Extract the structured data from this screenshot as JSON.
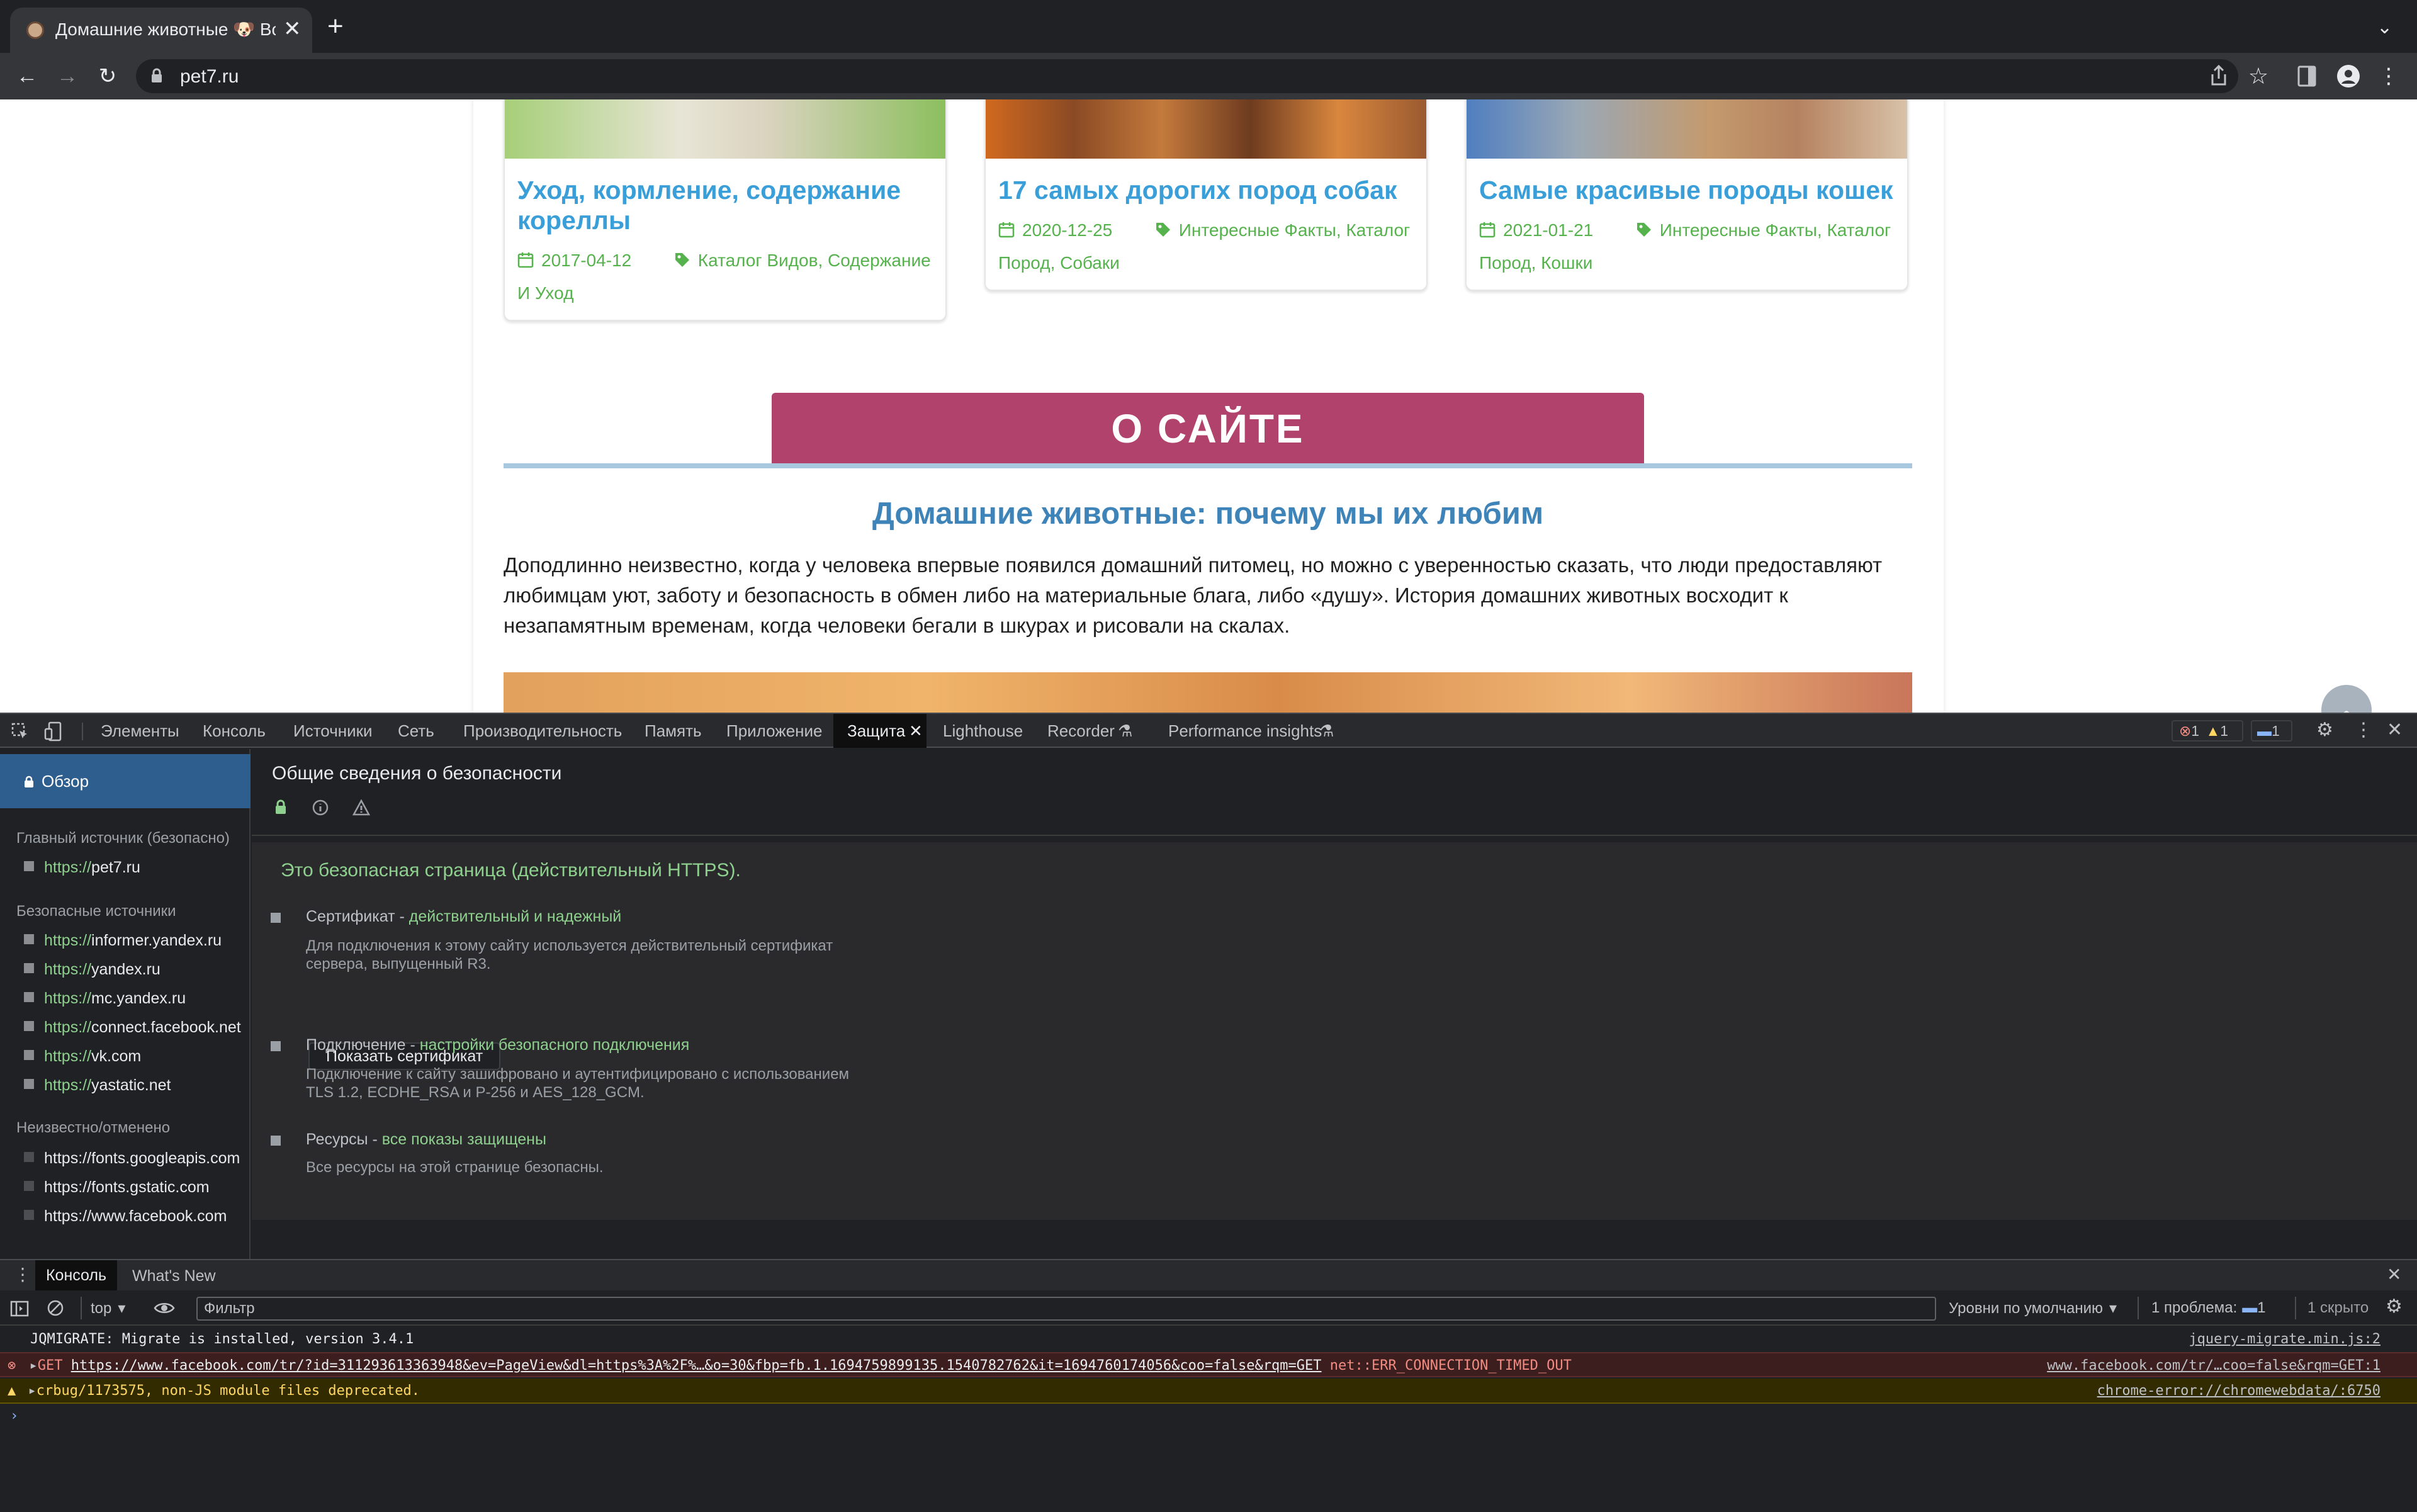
{
  "browser": {
    "tab_title": "Домашние животные 🐶 Все о",
    "url": "pet7.ru"
  },
  "page": {
    "cards": [
      {
        "title": "Уход, кормление, содержание кореллы",
        "date": "2017-04-12",
        "tags": "Каталог Видов, Содержание И Уход",
        "img_color": "#8fc164"
      },
      {
        "title": "17 самых дорогих пород собак",
        "date": "2020-12-25",
        "tags": "Интересные Факты, Каталог Пород, Собаки",
        "img_color": "#b5652d"
      },
      {
        "title": "Самые красивые породы кошек",
        "date": "2021-01-21",
        "tags": "Интересные Факты, Каталог Пород, Кошки",
        "img_color": "#b68a6a"
      }
    ],
    "about_banner": "О САЙТЕ",
    "about_heading": "Домашние животные: почему мы их любим",
    "about_text": "Доподлинно  неизвестно, когда у человека впервые появился домашний питомец, но можно с уверенностью сказать, что люди предоставляют любимцам уют, заботу и безопасность в обмен либо на материальные блага, либо «душу». История домашних животных восходит к незапамятным временам, когда человеки бегали в шкурах и рисовали на скалах."
  },
  "devtools": {
    "tabs": [
      "Элементы",
      "Консоль",
      "Источники",
      "Сеть",
      "Производительность",
      "Память",
      "Приложение",
      "Защита",
      "Lighthouse",
      "Recorder",
      "Performance insights"
    ],
    "active_tab": "Защита",
    "badges": {
      "errors": "1",
      "warnings": "1",
      "messages": "1"
    },
    "sidebar": {
      "overview": "Обзор",
      "main_origin_label": "Главный источник (безопасно)",
      "main_origin": {
        "scheme": "https://",
        "host": "pet7.ru"
      },
      "secure_label": "Безопасные источники",
      "secure_origins": [
        {
          "scheme": "https://",
          "host": "informer.yandex.ru"
        },
        {
          "scheme": "https://",
          "host": "yandex.ru"
        },
        {
          "scheme": "https://",
          "host": "mc.yandex.ru"
        },
        {
          "scheme": "https://",
          "host": "connect.facebook.net"
        },
        {
          "scheme": "https://",
          "host": "vk.com"
        },
        {
          "scheme": "https://",
          "host": "yastatic.net"
        }
      ],
      "unknown_label": "Неизвестно/отменено",
      "unknown_origins": [
        "https://fonts.googleapis.com",
        "https://fonts.gstatic.com",
        "https://www.facebook.com"
      ]
    },
    "security": {
      "title": "Общие сведения о безопасности",
      "summary": "Это безопасная страница (действительный HTTPS).",
      "cert_label": "Сертификат - ",
      "cert_status": "действительный и надежный",
      "cert_desc": "Для подключения к этому сайту используется действительный сертификат сервера, выпущенный R3.",
      "cert_button": "Показать сертификат",
      "conn_label": "Подключение - ",
      "conn_status": "настройки безопасного подключения",
      "conn_desc": "Подключение к сайту зашифровано и аутентифицировано с использованием TLS 1.2, ECDHE_RSA и P-256 и AES_128_GCM.",
      "res_label": "Ресурсы - ",
      "res_status": "все показы защищены",
      "res_desc": "Все ресурсы на этой странице безопасны."
    },
    "drawer": {
      "tab_console": "Консоль",
      "tab_whats_new": "What's New",
      "context": "top",
      "filter_placeholder": "Фильтр",
      "levels": "Уровни по умолчанию",
      "issues": "1 проблема:",
      "issues_count": "1",
      "hidden": "1 скрыто",
      "messages": [
        {
          "text": "JQMIGRATE: Migrate is installed, version 3.4.1",
          "source": "jquery-migrate.min.js:2",
          "level": "info"
        },
        {
          "prefix": "GET ",
          "url": "https://www.facebook.com/tr/?id=311293613363948&ev=PageView&dl=https%3A%2F%…&o=30&fbp=fb.1.1694759899135.1540782762&it=1694760174056&coo=false&rqm=GET",
          "error": " net::ERR_CONNECTION_TIMED_OUT",
          "source": "www.facebook.com/tr/…coo=false&rqm=GET:1",
          "level": "error"
        },
        {
          "text": "crbug/1173575, non-JS module files deprecated.",
          "source": "chrome-error://chromewebdata/:6750",
          "level": "warning"
        }
      ]
    }
  }
}
